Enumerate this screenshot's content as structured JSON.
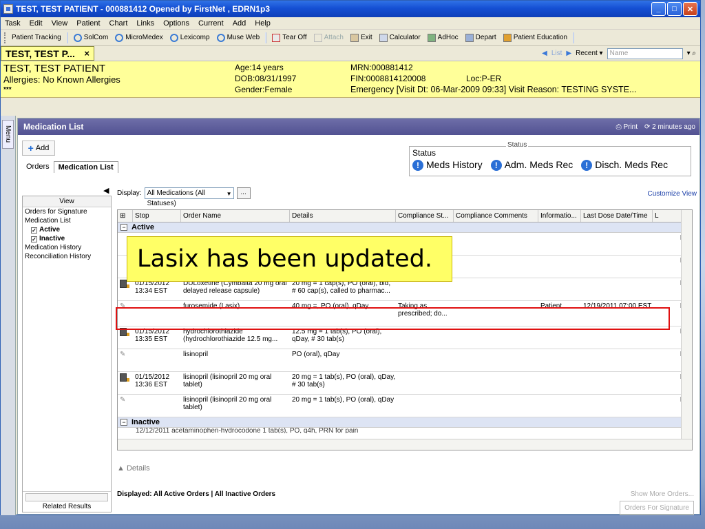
{
  "window": {
    "title": "TEST, TEST PATIENT - 000881412 Opened by FirstNet , EDRN1p3",
    "min": "_",
    "max": "□",
    "close": "✕"
  },
  "menu": [
    "Task",
    "Edit",
    "View",
    "Patient",
    "Chart",
    "Links",
    "Options",
    "Current",
    "Add",
    "Help"
  ],
  "toolbar": {
    "items": [
      "Patient Tracking",
      "SolCom",
      "MicroMedex",
      "Lexicomp",
      "Muse Web",
      "Tear Off",
      "Attach",
      "Exit",
      "Calculator",
      "AdHoc",
      "Depart",
      "Patient Education"
    ]
  },
  "patient_tab": {
    "label": "TEST, TEST P...",
    "close": "×"
  },
  "nav": {
    "list": "List",
    "recent": "Recent",
    "name_placeholder": "Name"
  },
  "banner": {
    "name": "TEST, TEST PATIENT",
    "allergies": "Allergies: No Known Allergies",
    "stars": "***",
    "age": "Age:14 years",
    "dob": "DOB:08/31/1997",
    "gender": "Gender:Female",
    "mrn": "MRN:000881412",
    "fin": "FIN:0008814120008",
    "loc": "Loc:P-ER",
    "visit": "Emergency [Visit Dt: 06-Mar-2009 09:33] Visit Reason: TESTING SYSTE..."
  },
  "side_menu": "Menu",
  "page": {
    "title": "Medication List",
    "print": "Print",
    "updated": "2 minutes ago",
    "add": "Add",
    "tabs": [
      "Orders",
      "Medication List"
    ]
  },
  "status": {
    "label": "Status",
    "label_small": "Status",
    "items": [
      "Meds History",
      "Adm. Meds Rec",
      "Disch. Meds Rec"
    ]
  },
  "leftnav": {
    "header": "View",
    "items": [
      "Orders for Signature",
      "Medication List",
      "Active",
      "Inactive",
      "Medication History",
      "Reconciliation History"
    ],
    "related": "Related Results"
  },
  "display": {
    "label": "Display:",
    "value": "All Medications (All Statuses)",
    "more": "...",
    "customize": "Customize View"
  },
  "grid": {
    "columns": [
      "Stop",
      "Order Name",
      "Details",
      "Compliance St...",
      "Compliance Comments",
      "Informatio...",
      "Last Dose Date/Time",
      "L"
    ],
    "active_label": "Active",
    "inactive_label": "Inactive",
    "rows": [
      {
        "stop": "",
        "order": "",
        "details": "",
        "comp": "",
        "compc": "",
        "info": "",
        "last": "",
        "x": "F"
      },
      {
        "stop": "",
        "order": "",
        "details": "",
        "comp": "",
        "compc": "",
        "info": "",
        "last": "",
        "x": "F"
      },
      {
        "stop": "01/15/2012 13:34 EST",
        "order": "DULoxetine (Cymbalta 20 mg oral delayed release capsule)",
        "details": "20 mg = 1 cap(s), PO (oral), bid, # 60 cap(s), called to pharmac...",
        "comp": "",
        "compc": "",
        "info": "",
        "last": "",
        "x": "F"
      },
      {
        "stop": "",
        "order": "furosemide (Lasix)",
        "details": "40 mg =, PO (oral), qDay",
        "comp": "Taking as prescribed; do...",
        "compc": "",
        "info": "Patient",
        "last": "12/19/2011 07:00 EST",
        "x": "F"
      },
      {
        "stop": "01/15/2012 13:35 EST",
        "order": "hydrochlorothiazide (hydrochlorothiazide 12.5 mg...",
        "details": "12.5 mg = 1 tab(s), PO (oral), qDay, # 30 tab(s)",
        "comp": "",
        "compc": "",
        "info": "",
        "last": "",
        "x": "F"
      },
      {
        "stop": "",
        "order": "lisinopril",
        "details": "PO (oral), qDay",
        "comp": "",
        "compc": "",
        "info": "",
        "last": "",
        "x": "F"
      },
      {
        "stop": "01/15/2012 13:36 EST",
        "order": "lisinopril (lisinopril 20 mg oral tablet)",
        "details": "20 mg = 1 tab(s), PO (oral), qDay, # 30 tab(s)",
        "comp": "",
        "compc": "",
        "info": "",
        "last": "",
        "x": "F"
      },
      {
        "stop": "",
        "order": "lisinopril (lisinopril 20 mg oral tablet)",
        "details": "20 mg = 1 tab(s), PO (oral), qDay",
        "comp": "",
        "compc": "",
        "info": "",
        "last": "",
        "x": "F"
      }
    ],
    "inactive_partial": "12/12/2011      acetaminophen-hydrocodone      1 tab(s), PO, q4h, PRN for pain"
  },
  "callout": "Lasix has been updated.",
  "details_label": "Details",
  "footer": {
    "displayed": "Displayed: All Active Orders | All Inactive Orders",
    "show_more": "Show More Orders...",
    "ofs": "Orders For Signature"
  }
}
